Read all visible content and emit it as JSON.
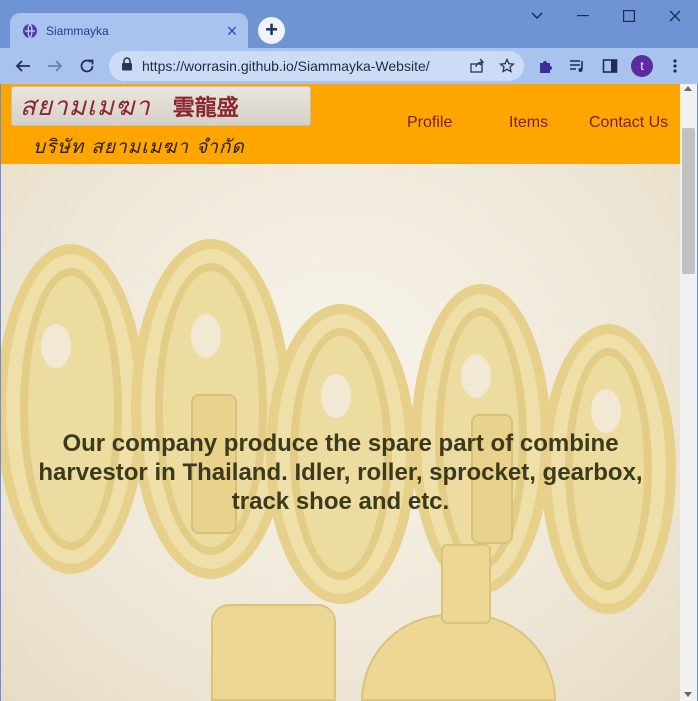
{
  "browser": {
    "tab": {
      "title": "Siammayka"
    },
    "new_tab_label": "+",
    "address_bar": {
      "url": "https://worrasin.github.io/Siammayka-Website/"
    },
    "profile_initial": "t"
  },
  "site": {
    "logo": {
      "thai": "สยามเมฆา",
      "chinese": "雲龍盛",
      "subtitle": "บริษัท สยามเมฆา จำกัด"
    },
    "nav": [
      {
        "label": "Profile"
      },
      {
        "label": "Items"
      },
      {
        "label": "Contact Us"
      }
    ],
    "hero": {
      "text": "Our company produce the spare part of combine harvestor in Thailand. Idler, roller, sprocket, gearbox, track shoe and etc."
    }
  },
  "colors": {
    "header_bg": "#ffa500",
    "nav_text": "#7a1e2a",
    "chrome_bg": "#6f94d4",
    "hero_text": "#3b3a1c"
  }
}
